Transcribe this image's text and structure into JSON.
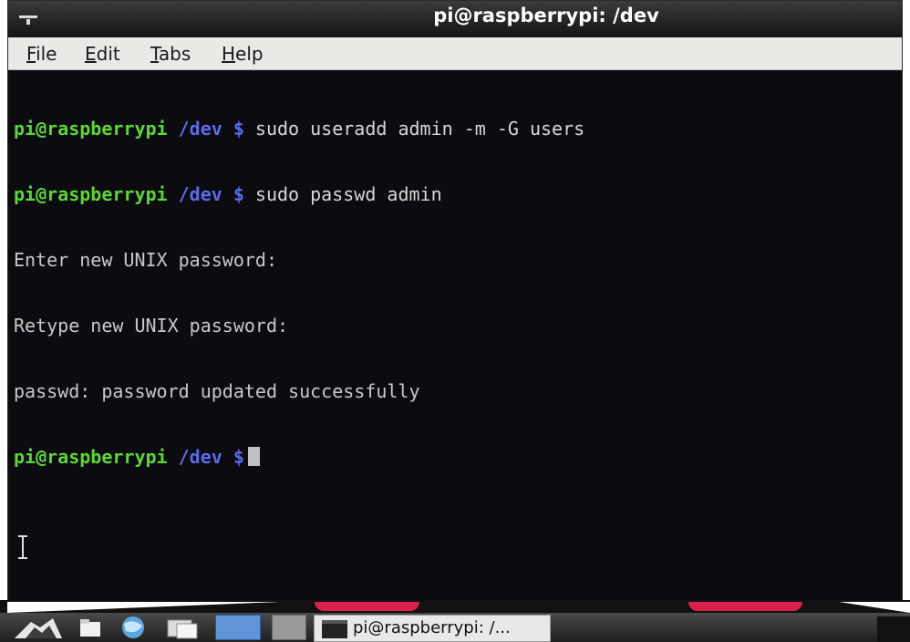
{
  "window": {
    "title": "pi@raspberrypi: /dev"
  },
  "menu": {
    "file": {
      "mnemonic": "F",
      "rest": "ile"
    },
    "edit": {
      "mnemonic": "E",
      "rest": "dit"
    },
    "tabs": {
      "mnemonic": "T",
      "rest": "abs"
    },
    "help": {
      "mnemonic": "H",
      "rest": "elp"
    }
  },
  "terminal": {
    "lines": [
      {
        "user": "pi@raspberrypi",
        "path": "/dev $",
        "cmd": " sudo useradd admin -m -G users"
      },
      {
        "user": "pi@raspberrypi",
        "path": "/dev $",
        "cmd": " sudo passwd admin"
      },
      {
        "output": "Enter new UNIX password:"
      },
      {
        "output": "Retype new UNIX password:"
      },
      {
        "output": "passwd: password updated successfully"
      },
      {
        "user": "pi@raspberrypi",
        "path": "/dev $",
        "cmd": ""
      }
    ]
  },
  "taskbar": {
    "task_label": "pi@raspberrypi: /..."
  },
  "icons": {
    "window_menu": "window-menu-icon",
    "start": "lxde-start-icon",
    "file_manager": "file-manager-icon",
    "browser": "web-browser-icon",
    "desktop": "show-desktop-icon",
    "terminal": "terminal-icon"
  },
  "colors": {
    "prompt_user": "#5bd636",
    "prompt_path": "#5d6bea",
    "terminal_bg": "#0b0b10",
    "accent_red": "#d8204b"
  }
}
